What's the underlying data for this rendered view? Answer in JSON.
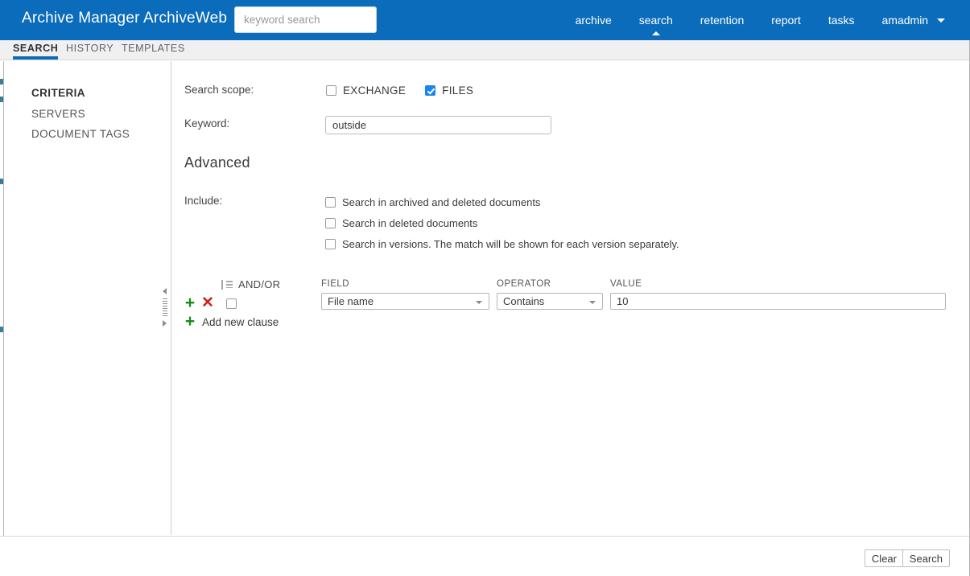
{
  "header": {
    "app_title": "Archive Manager ArchiveWeb",
    "search_placeholder": "keyword search",
    "search_value": "",
    "nav": [
      {
        "label": "archive",
        "active": false
      },
      {
        "label": "search",
        "active": true
      },
      {
        "label": "retention",
        "active": false
      },
      {
        "label": "report",
        "active": false
      },
      {
        "label": "tasks",
        "active": false
      },
      {
        "label": "amadmin",
        "active": false
      }
    ],
    "brand_color": "#0a6cba"
  },
  "tabs": [
    {
      "label": "SEARCH",
      "active": true
    },
    {
      "label": "HISTORY",
      "active": false
    },
    {
      "label": "TEMPLATES",
      "active": false
    }
  ],
  "sidebar": {
    "items": [
      {
        "label": "CRITERIA",
        "active": true
      },
      {
        "label": "SERVERS",
        "active": false
      },
      {
        "label": "DOCUMENT TAGS",
        "active": false
      }
    ]
  },
  "main": {
    "search_scope": {
      "label": "Search scope:",
      "options": [
        {
          "label": "EXCHANGE",
          "checked": false
        },
        {
          "label": "FILES",
          "checked": true
        }
      ]
    },
    "keyword": {
      "label": "Keyword:",
      "value": "outside",
      "placeholder": ""
    },
    "advanced_heading": "Advanced",
    "include": {
      "label": "Include:",
      "options": [
        {
          "label": "Search in archived and deleted documents",
          "checked": false
        },
        {
          "label": "Search in deleted documents",
          "checked": false
        },
        {
          "label": "Search in versions. The match will be shown for each version separately.",
          "checked": false
        }
      ]
    },
    "clause_builder": {
      "andor_label": "AND/OR",
      "column_headers": {
        "field": "FIELD",
        "operator": "OPERATOR",
        "value": "VALUE"
      },
      "add_new_clause_label": "Add new clause",
      "plus_glyph": "+",
      "remove_glyph": "✕",
      "add_glyph": "+",
      "rows": [
        {
          "selected": false,
          "andor": "",
          "field": "File name",
          "operator": "Contains",
          "value": "10"
        }
      ]
    }
  },
  "footer": {
    "clear_label": "Clear",
    "search_label": "Search"
  }
}
